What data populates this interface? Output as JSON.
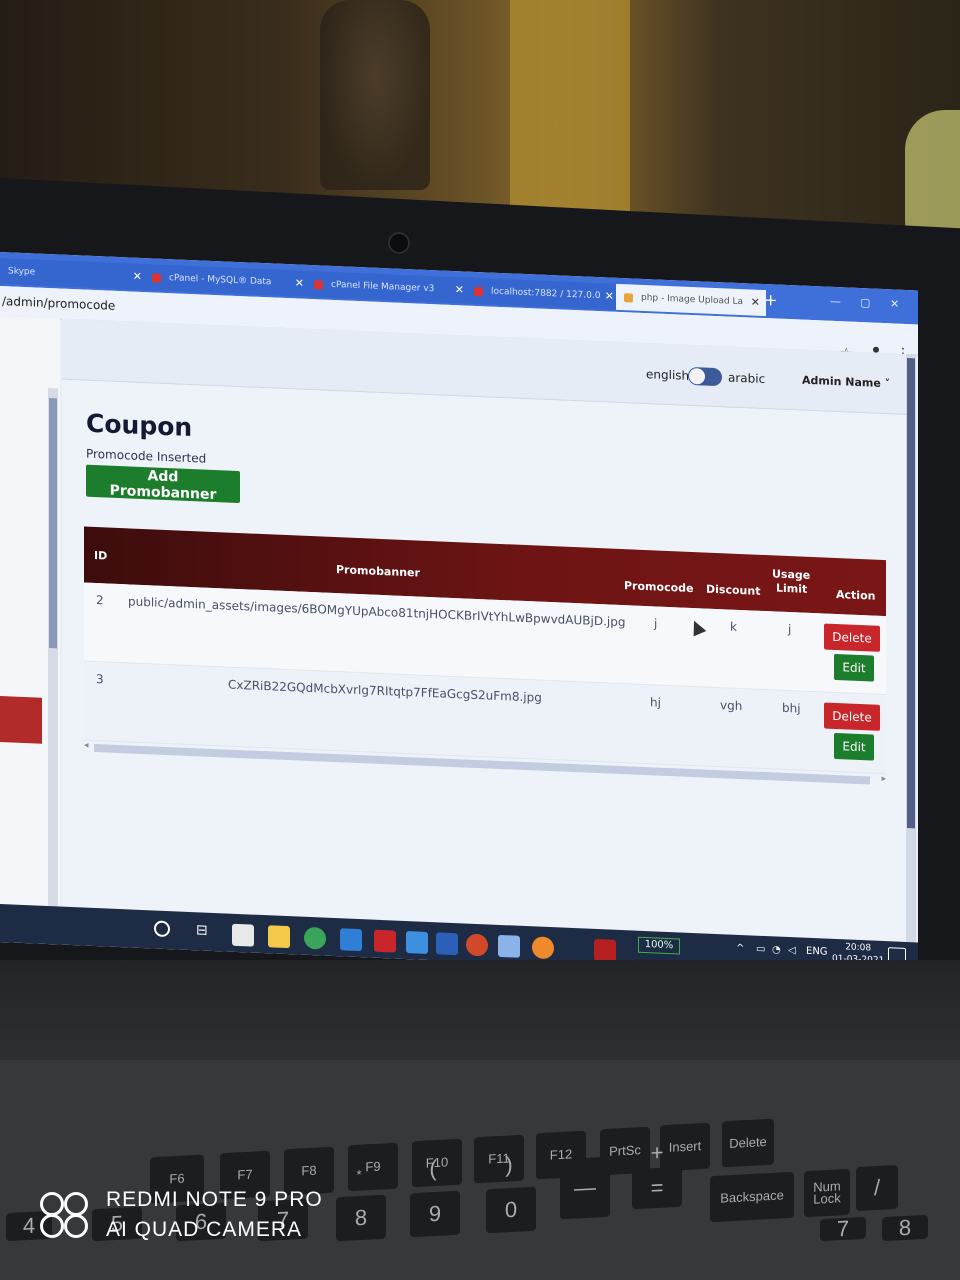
{
  "browser": {
    "tabs": [
      {
        "label": "Skype"
      },
      {
        "label": "cPanel - MySQL® Data"
      },
      {
        "label": "cPanel File Manager v3"
      },
      {
        "label": "localhost:7882 / 127.0.0"
      },
      {
        "label": "php - Image Upload La"
      }
    ],
    "new_tab": "+",
    "url": "/admin/promocode"
  },
  "topnav": {
    "lang_left": "english",
    "lang_right": "arabic",
    "admin": "Admin Name ˅"
  },
  "page": {
    "title": "Coupon",
    "status": "Promocode Inserted",
    "add_button": "Add Promobanner"
  },
  "table": {
    "headers": {
      "id": "ID",
      "promobanner": "Promobanner",
      "promocode": "Promocode",
      "discount": "Discount",
      "usage_limit_1": "Usage",
      "usage_limit_2": "Limit",
      "action": "Action"
    },
    "rows": [
      {
        "id": "2",
        "promobanner": "public/admin_assets/images/6BOMgYUpAbco81tnjHOCKBrIVtYhLwBpwvdAUBjD.jpg",
        "promocode": "j",
        "discount": "k",
        "usage_limit": "j",
        "delete": "Delete",
        "edit": "Edit"
      },
      {
        "id": "3",
        "promobanner": "CxZRiB22GQdMcbXvrlg7RItqtp7FfEaGcgS2uFm8.jpg",
        "promocode": "hj",
        "discount": "vgh",
        "usage_limit": "bhj",
        "delete": "Delete",
        "edit": "Edit"
      }
    ]
  },
  "taskbar": {
    "zoom": "100%",
    "lang": "ENG",
    "time": "20:08",
    "date": "01-03-2021"
  },
  "keyboard": {
    "keys": [
      "PrtSc",
      "Insert",
      "Delete",
      "Backspace",
      "Num Lock",
      "F10",
      "F11",
      "F12",
      "F9",
      "F8",
      "F7",
      "F6",
      "8",
      "9",
      "0",
      "7",
      "6",
      "5",
      "4",
      "*",
      "(",
      ")",
      "—",
      "+",
      "=",
      "/",
      "7",
      "8"
    ]
  },
  "watermark": {
    "line1": "REDMI NOTE 9 PRO",
    "line2": "AI QUAD CAMERA"
  },
  "colors": {
    "header_dark": "#3c0c0c",
    "header_red": "#7a1616",
    "delete": "#c8262a",
    "edit_add": "#1c7e2c",
    "tabbar": "#3f6fd8",
    "taskbar": "#1e2b45"
  }
}
